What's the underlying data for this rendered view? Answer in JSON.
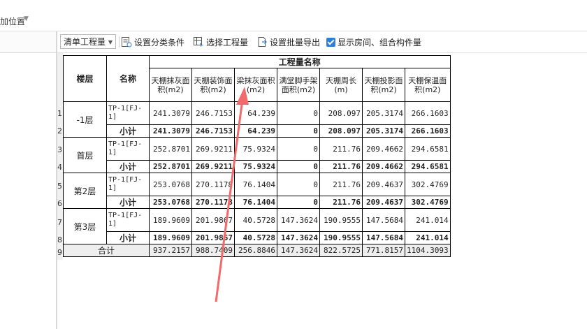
{
  "location": {
    "label": "加位置"
  },
  "toolbar": {
    "select_value": "清单工程量",
    "classify_label": "设置分类条件",
    "select_qty_label": "选择工程量",
    "batch_export_label": "设置批量导出",
    "show_rooms_label": "显示房间、组合构件量",
    "show_rooms_checked": true
  },
  "table": {
    "group_header": "工程量名称",
    "col_floor": "楼层",
    "col_name": "名称",
    "columns": [
      "天棚抹灰面积(m2)",
      "天棚装饰面积(m2)",
      "梁抹灰面积(m2)",
      "满堂脚手架面积(m2)",
      "天棚周长(m)",
      "天棚投影面积(m2)",
      "天棚保温面积(m2)"
    ],
    "row_numbers": [
      "1",
      "2",
      "3",
      "4",
      "5",
      "6",
      "7",
      "8",
      "9"
    ],
    "floors": [
      {
        "floor": "-1层",
        "item": "TP-1[FJ-1]",
        "values": [
          "241.3079",
          "246.7153",
          "64.239",
          "0",
          "208.097",
          "205.3174",
          "266.1603"
        ],
        "subtotal_label": "小计",
        "subtotal": [
          "241.3079",
          "246.7153",
          "64.239",
          "0",
          "208.097",
          "205.3174",
          "266.1603"
        ]
      },
      {
        "floor": "首层",
        "item": "TP-1[FJ-1]",
        "values": [
          "252.8701",
          "269.9211",
          "75.9324",
          "0",
          "211.76",
          "209.4662",
          "294.6581"
        ],
        "subtotal_label": "小计",
        "subtotal": [
          "252.8701",
          "269.9211",
          "75.9324",
          "0",
          "211.76",
          "209.4662",
          "294.6581"
        ]
      },
      {
        "floor": "第2层",
        "item": "TP-1[FJ-1]",
        "values": [
          "253.0768",
          "270.1178",
          "76.1404",
          "0",
          "211.76",
          "209.4637",
          "302.4769"
        ],
        "subtotal_label": "小计",
        "subtotal": [
          "253.0768",
          "270.1178",
          "76.1404",
          "0",
          "211.76",
          "209.4637",
          "302.4769"
        ]
      },
      {
        "floor": "第3层",
        "item": "TP-1[FJ-1]",
        "values": [
          "189.9609",
          "201.9867",
          "40.5728",
          "147.3624",
          "190.9555",
          "147.5684",
          "241.014"
        ],
        "subtotal_label": "小计",
        "subtotal": [
          "189.9609",
          "201.9867",
          "40.5728",
          "147.3624",
          "190.9555",
          "147.5684",
          "241.014"
        ]
      }
    ],
    "total_label": "合计",
    "total": [
      "937.2157",
      "988.7409",
      "256.8846",
      "147.3624",
      "822.5725",
      "771.8157",
      "1104.3093"
    ]
  },
  "annotation": {
    "arrow_color": "#f26a6a"
  }
}
